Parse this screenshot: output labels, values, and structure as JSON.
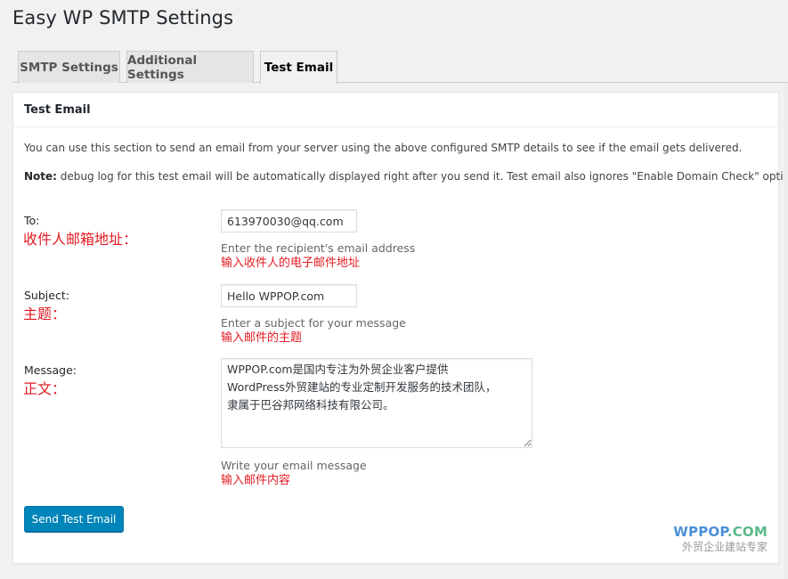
{
  "page": {
    "title": "Easy WP SMTP Settings"
  },
  "tabs": [
    {
      "label": "SMTP Settings",
      "active": false
    },
    {
      "label": "Additional Settings",
      "active": false
    },
    {
      "label": "Test Email",
      "active": true
    }
  ],
  "panel": {
    "title": "Test Email",
    "intro": "You can use this section to send an email from your server using the above configured SMTP details to see if the email gets delivered.",
    "note_label": "Note:",
    "note_text": " debug log for this test email will be automatically displayed right after you send it. Test email also ignores \"Enable Domain Check\" option."
  },
  "form": {
    "to": {
      "label": "To:",
      "label_cn": "收件人邮箱地址：",
      "value": "613970030@qq.com",
      "description": "Enter the recipient's email address",
      "description_cn": "输入收件人的电子邮件地址"
    },
    "subject": {
      "label": "Subject:",
      "label_cn": "主题：",
      "value": "Hello WPPOP.com",
      "description": "Enter a subject for your message",
      "description_cn": "输入邮件的主题"
    },
    "message": {
      "label": "Message:",
      "label_cn": "正文：",
      "value": "WPPOP.com是国内专注为外贸企业客户提供\nWordPress外贸建站的专业定制开发服务的技术团队，\n隶属于巴谷邦网络科技有限公司。",
      "description": "Write your email message",
      "description_cn": "输入邮件内容"
    },
    "submit_label": "Send Test Email"
  },
  "watermark": {
    "brand_part1": "WPPOP",
    "brand_part2": ".COM",
    "tagline": "外贸企业建站专家"
  },
  "colors": {
    "accent": "#0085ba",
    "annotation": "#e31b23",
    "watermark_blue": "#4a90d9",
    "watermark_green": "#5cb88a"
  }
}
